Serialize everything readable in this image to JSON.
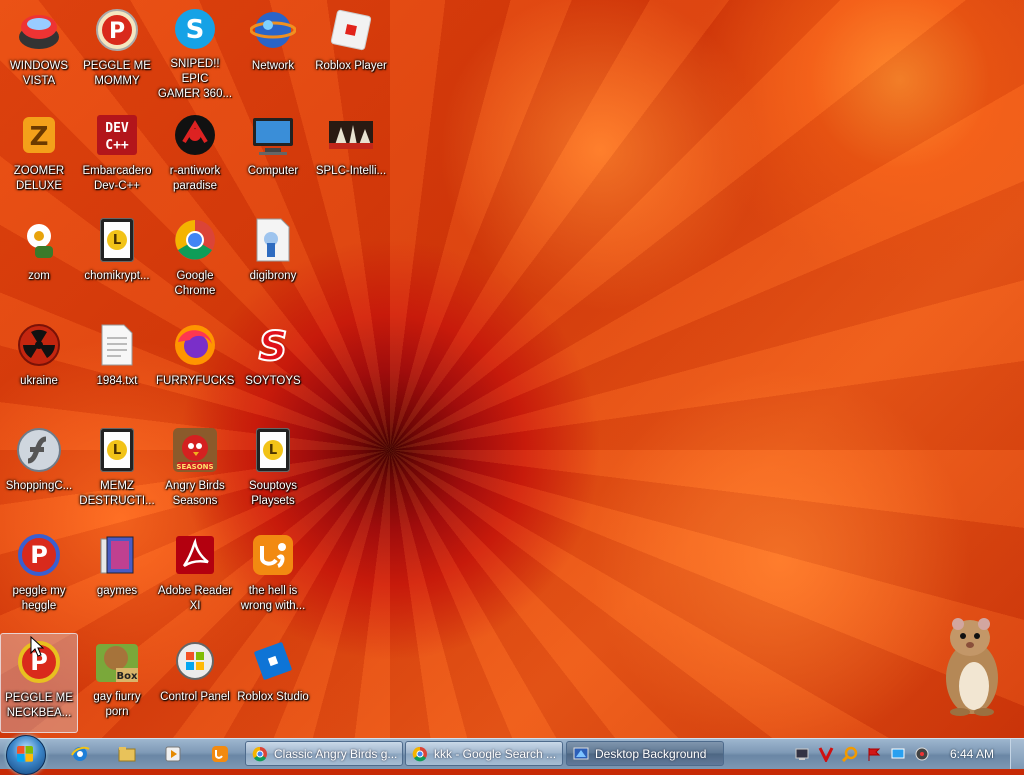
{
  "desktop": {
    "icons": [
      {
        "label": "WINDOWS\nVISTA",
        "icon": "vista-logo-icon"
      },
      {
        "label": "PEGGLE ME\nMOMMY",
        "icon": "peggle-icon"
      },
      {
        "label": "SNIPED!! EPIC\nGAMER 360...",
        "icon": "skype-icon"
      },
      {
        "label": "Network",
        "icon": "network-globe-icon"
      },
      {
        "label": "Roblox Player",
        "icon": "roblox-icon"
      },
      {
        "label": "ZOOMER\nDELUXE",
        "icon": "zoomer-icon"
      },
      {
        "label": "Embarcadero\nDev-C++",
        "icon": "devcpp-icon"
      },
      {
        "label": "r-antiwork\nparadise",
        "icon": "antiwork-icon"
      },
      {
        "label": "Computer",
        "icon": "computer-icon"
      },
      {
        "label": "SPLC-Intelli...",
        "icon": "splc-icon"
      },
      {
        "label": "zom",
        "icon": "flower-icon"
      },
      {
        "label": "chomikrypt...",
        "icon": "secured-file-icon"
      },
      {
        "label": "Google\nChrome",
        "icon": "chrome-icon"
      },
      {
        "label": "digibrony",
        "icon": "digibrony-icon"
      },
      {
        "label": "ukraine",
        "icon": "radiation-icon"
      },
      {
        "label": "1984.txt",
        "icon": "text-file-icon"
      },
      {
        "label": "FURRYFUCKS",
        "icon": "firefox-icon"
      },
      {
        "label": "SOYTOYS",
        "icon": "soytoys-icon"
      },
      {
        "label": "ShoppingC...",
        "icon": "flash-icon"
      },
      {
        "label": "MEMZ\nDESTRUCTI...",
        "icon": "secured-file-icon"
      },
      {
        "label": "Angry Birds\nSeasons",
        "icon": "angry-birds-icon"
      },
      {
        "label": "Souptoys\nPlaysets",
        "icon": "secured-file-icon"
      },
      {
        "label": "peggle my\nheggle",
        "icon": "peggle-icon"
      },
      {
        "label": "gaymes",
        "icon": "folder-icon"
      },
      {
        "label": "Adobe Reader\nXI",
        "icon": "adobe-reader-icon"
      },
      {
        "label": "the hell is\nwrong with...",
        "icon": "uc-browser-icon"
      },
      {
        "label": "PEGGLE ME\nNECKBEA...",
        "icon": "peggle-icon"
      },
      {
        "label": "gay fiurry\nporn",
        "icon": "box-hamster-icon"
      },
      {
        "label": "Control Panel",
        "icon": "control-panel-icon"
      },
      {
        "label": "Roblox Studio",
        "icon": "roblox-studio-icon"
      }
    ]
  },
  "taskbar": {
    "windows": [
      {
        "label": "Classic Angry Birds g...",
        "icon": "chrome-icon"
      },
      {
        "label": "kkk - Google Search ...",
        "icon": "chrome-icon"
      },
      {
        "label": "Desktop Background",
        "icon": "personalize-icon"
      }
    ],
    "clock": "6:44 AM"
  },
  "colors": {
    "accent": "#e8480f",
    "taskbar": "#7f9ab6",
    "label_text": "#ffffff"
  }
}
